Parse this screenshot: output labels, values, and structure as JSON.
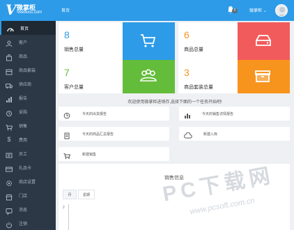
{
  "header": {
    "logo_cn": "微掌柜",
    "logo_en": "Veeboss.com",
    "logo_mark": "V",
    "breadcrumb": "首页",
    "notification_count": "0",
    "user_name": "微掌柜"
  },
  "sidebar": {
    "items": [
      {
        "label": "首页",
        "icon": "dashboard-icon"
      },
      {
        "label": "客户",
        "icon": "user-icon"
      },
      {
        "label": "商品",
        "icon": "bag-icon"
      },
      {
        "label": "商品套装",
        "icon": "box-icon"
      },
      {
        "label": "供应商",
        "icon": "truck-icon"
      },
      {
        "label": "报告",
        "icon": "report-icon"
      },
      {
        "label": "采购",
        "icon": "purchase-icon"
      },
      {
        "label": "销售",
        "icon": "cart-icon"
      },
      {
        "label": "费用",
        "icon": "dollar-icon"
      },
      {
        "label": "员工",
        "icon": "staff-icon"
      },
      {
        "label": "礼品卡",
        "icon": "card-icon"
      },
      {
        "label": "商店设置",
        "icon": "settings-icon"
      },
      {
        "label": "门店",
        "icon": "store-icon"
      },
      {
        "label": "消息",
        "icon": "message-icon"
      },
      {
        "label": "注销",
        "icon": "logout-icon"
      }
    ]
  },
  "stats": [
    {
      "value": "8",
      "label": "销售总量",
      "color": "#2d9be8",
      "value_color": "#2d9be8",
      "icon": "cart-icon"
    },
    {
      "value": "6",
      "label": "商品总量",
      "color": "#f25b5b",
      "value_color": "#f25b5b",
      "icon": "drive-icon"
    },
    {
      "value": "7",
      "label": "客户总量",
      "color": "#64bd3a",
      "value_color": "#64bd3a",
      "icon": "group-icon"
    },
    {
      "value": "3",
      "label": "商品套装总量",
      "color": "#f7941d",
      "value_color": "#f7941d",
      "icon": "box-icon"
    }
  ],
  "info_text": "欢迎使用微掌柜进销存,选择下面的一个任务开始吧!",
  "tasks": [
    {
      "label": "今天的出货报告",
      "icon": "clock-icon"
    },
    {
      "label": "今天的销售详情报告",
      "icon": "bar-chart-icon"
    },
    {
      "label": "今天的商品汇总报告",
      "icon": "document-icon"
    },
    {
      "label": "新建入库",
      "icon": "cloud-icon"
    },
    {
      "label": "新建销售",
      "icon": "cart-icon"
    }
  ],
  "sales": {
    "title": "销售信息",
    "tabs": [
      "月",
      "星期"
    ],
    "y_tick": "2"
  },
  "watermark": {
    "text": "PC下载网",
    "url": "www.pcsoft.com.cn"
  }
}
